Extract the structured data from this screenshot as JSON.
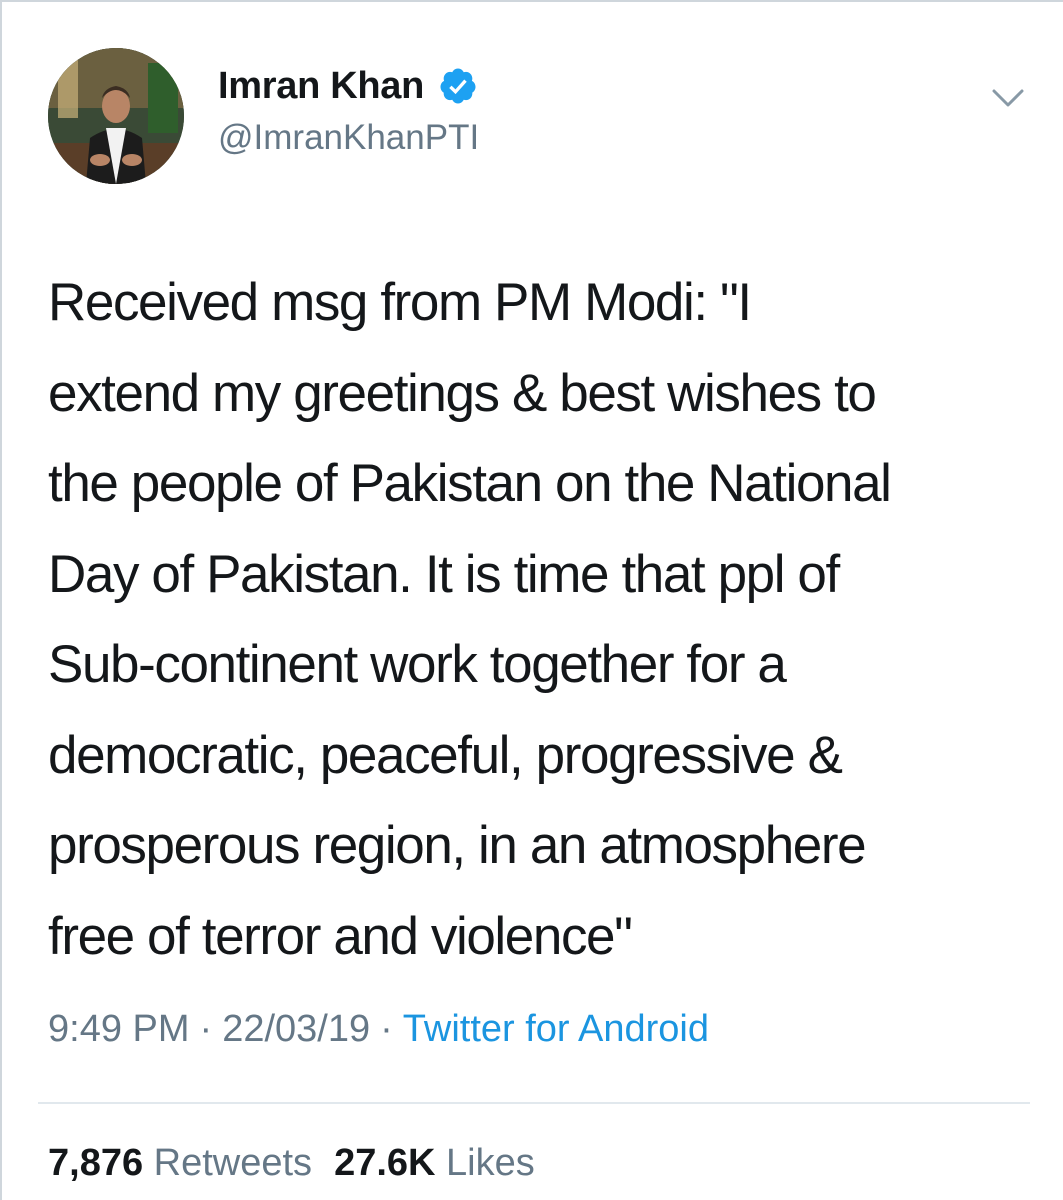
{
  "author": {
    "display_name": "Imran Khan",
    "handle": "@ImranKhanPTI",
    "verified": true,
    "avatar_icon": "profile-photo"
  },
  "tweet": {
    "text": "Received msg from PM Modi: \"I\nextend my greetings & best wishes to\nthe people of Pakistan on the National\nDay of Pakistan. It is time that ppl of\nSub-continent work together for a\ndemocratic, peaceful, progressive &\nprosperous region, in an atmosphere\nfree of terror and violence\"",
    "time": "9:49 PM",
    "separator": "·",
    "date": "22/03/19",
    "source": "Twitter for Android"
  },
  "stats": {
    "retweets_count": "7,876",
    "retweets_label": "Retweets",
    "likes_count": "27.6K",
    "likes_label": "Likes"
  },
  "colors": {
    "text_primary": "#14171a",
    "text_secondary": "#657786",
    "link_blue": "#1b95e0",
    "verified_blue": "#1da1f2"
  },
  "icons": {
    "verified": "verified-badge-icon",
    "menu": "chevron-down-icon"
  }
}
